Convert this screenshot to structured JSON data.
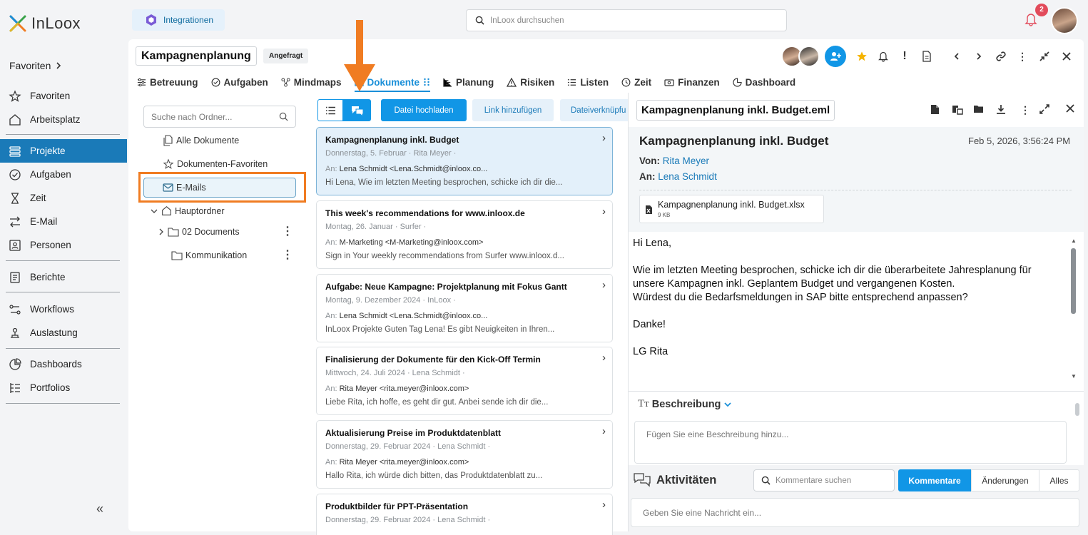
{
  "app": {
    "logo_text": "InLoox"
  },
  "leftnav": {
    "favorites_header": "Favoriten",
    "items": [
      {
        "label": "Favoriten",
        "icon": "star-icon"
      },
      {
        "label": "Arbeitsplatz",
        "icon": "home-icon"
      },
      {
        "label": "Projekte",
        "icon": "projects-icon",
        "active": true
      },
      {
        "label": "Aufgaben",
        "icon": "check-circle-icon"
      },
      {
        "label": "Zeit",
        "icon": "hourglass-icon"
      },
      {
        "label": "E-Mail",
        "icon": "email-swap-icon"
      },
      {
        "label": "Personen",
        "icon": "contact-card-icon"
      },
      {
        "label": "Berichte",
        "icon": "report-icon"
      },
      {
        "label": "Workflows",
        "icon": "workflow-icon"
      },
      {
        "label": "Auslastung",
        "icon": "workload-icon"
      },
      {
        "label": "Dashboards",
        "icon": "pie-chart-icon"
      },
      {
        "label": "Portfolios",
        "icon": "portfolio-icon"
      }
    ],
    "collapse_glyph": "«"
  },
  "topbar": {
    "integrations_label": "Integrationen",
    "search_placeholder": "InLoox durchsuchen",
    "notification_count": "2"
  },
  "project": {
    "title": "Kampagnenplanung",
    "status": "Angefragt",
    "tabs": [
      {
        "label": "Betreuung"
      },
      {
        "label": "Aufgaben"
      },
      {
        "label": "Mindmaps"
      },
      {
        "label": "Dokumente",
        "active": true
      },
      {
        "label": "Planung"
      },
      {
        "label": "Risiken"
      },
      {
        "label": "Listen"
      },
      {
        "label": "Zeit"
      },
      {
        "label": "Finanzen"
      },
      {
        "label": "Dashboard"
      }
    ]
  },
  "folders": {
    "search_placeholder": "Suche nach Ordner...",
    "all_docs": "Alle Dokumente",
    "doc_favorites": "Dokumenten-Favoriten",
    "emails": "E-Mails",
    "main_folder": "Hauptordner",
    "sub1": "02 Documents",
    "sub2": "Kommunikation"
  },
  "toolbar": {
    "upload": "Datei hochladen",
    "add_link": "Link hinzufügen",
    "file_link": "Dateiverknüpfu"
  },
  "emails": [
    {
      "subject": "Kampagnenplanung inkl. Budget",
      "date": "Donnerstag, 5. Februar",
      "sender": "Rita Meyer",
      "to": "Lena Schmidt <Lena.Schmidt@inloox.co...",
      "preview": "Hi Lena, Wie im letzten Meeting besprochen, schicke ich dir die...",
      "selected": true
    },
    {
      "subject": "This week's recommendations for www.inloox.de",
      "date": "Montag, 26. Januar",
      "sender": "Surfer",
      "to": "M-Marketing <M-Marketing@inloox.com>",
      "preview": "Sign in Your weekly recommendations from Surfer www.inloox.d..."
    },
    {
      "subject": "Aufgabe: Neue Kampagne: Projektplanung mit Fokus Gantt",
      "date": "Montag, 9. Dezember 2024",
      "sender": "InLoox",
      "to": "Lena Schmidt <Lena.Schmidt@inloox.co...",
      "preview": "InLoox Projekte Guten Tag Lena! Es gibt Neuigkeiten in Ihren..."
    },
    {
      "subject": "Finalisierung der Dokumente für den Kick-Off Termin",
      "date": "Mittwoch, 24. Juli 2024",
      "sender": "Lena Schmidt",
      "to": "Rita Meyer <rita.meyer@inloox.com>",
      "preview": "Liebe Rita, ich hoffe, es geht dir gut. Anbei sende ich dir die..."
    },
    {
      "subject": "Aktualisierung Preise im Produktdatenblatt",
      "date": "Donnerstag, 29. Februar 2024",
      "sender": "Lena Schmidt",
      "to": "Rita Meyer <rita.meyer@inloox.com>",
      "preview": "Hallo Rita, ich würde dich bitten, das Produktdatenblatt zu..."
    },
    {
      "subject": "Produktbilder für PPT-Präsentation",
      "date": "Donnerstag, 29. Februar 2024",
      "sender": "Lena Schmidt",
      "to": "",
      "preview": ""
    }
  ],
  "to_label": "An:",
  "preview": {
    "filename": "Kampagnenplanung inkl. Budget.eml",
    "subject": "Kampagnenplanung inkl. Budget",
    "date": "Feb 5, 2026, 3:56:24 PM",
    "from_label": "Von:",
    "from": "Rita Meyer",
    "to_label": "An:",
    "to": "Lena Schmidt",
    "attachment_name": "Kampagnenplanung inkl. Budget.xlsx",
    "attachment_size": "9 KB",
    "body": [
      "Hi Lena,",
      "",
      "Wie im letzten Meeting besprochen, schicke ich dir die überarbeitete Jahresplanung für",
      "unsere Kampagnen inkl. Geplantem Budget und vergangenen Kosten.",
      "Würdest du die Bedarfsmeldungen in SAP bitte entsprechend anpassen?",
      "",
      "Danke!",
      "",
      "LG Rita"
    ],
    "description_title": "Beschreibung",
    "description_placeholder": "Fügen Sie eine Beschreibung hinzu...",
    "activities_title": "Aktivitäten",
    "comments_search_placeholder": "Kommentare suchen",
    "seg_comments": "Kommentare",
    "seg_changes": "Änderungen",
    "seg_all": "Alles",
    "message_placeholder": "Geben Sie eine Nachricht ein..."
  },
  "colors": {
    "accent": "#1196e6",
    "nav_active": "#1a7ab8",
    "highlight": "#f07c22",
    "badge": "#e24b5b"
  }
}
